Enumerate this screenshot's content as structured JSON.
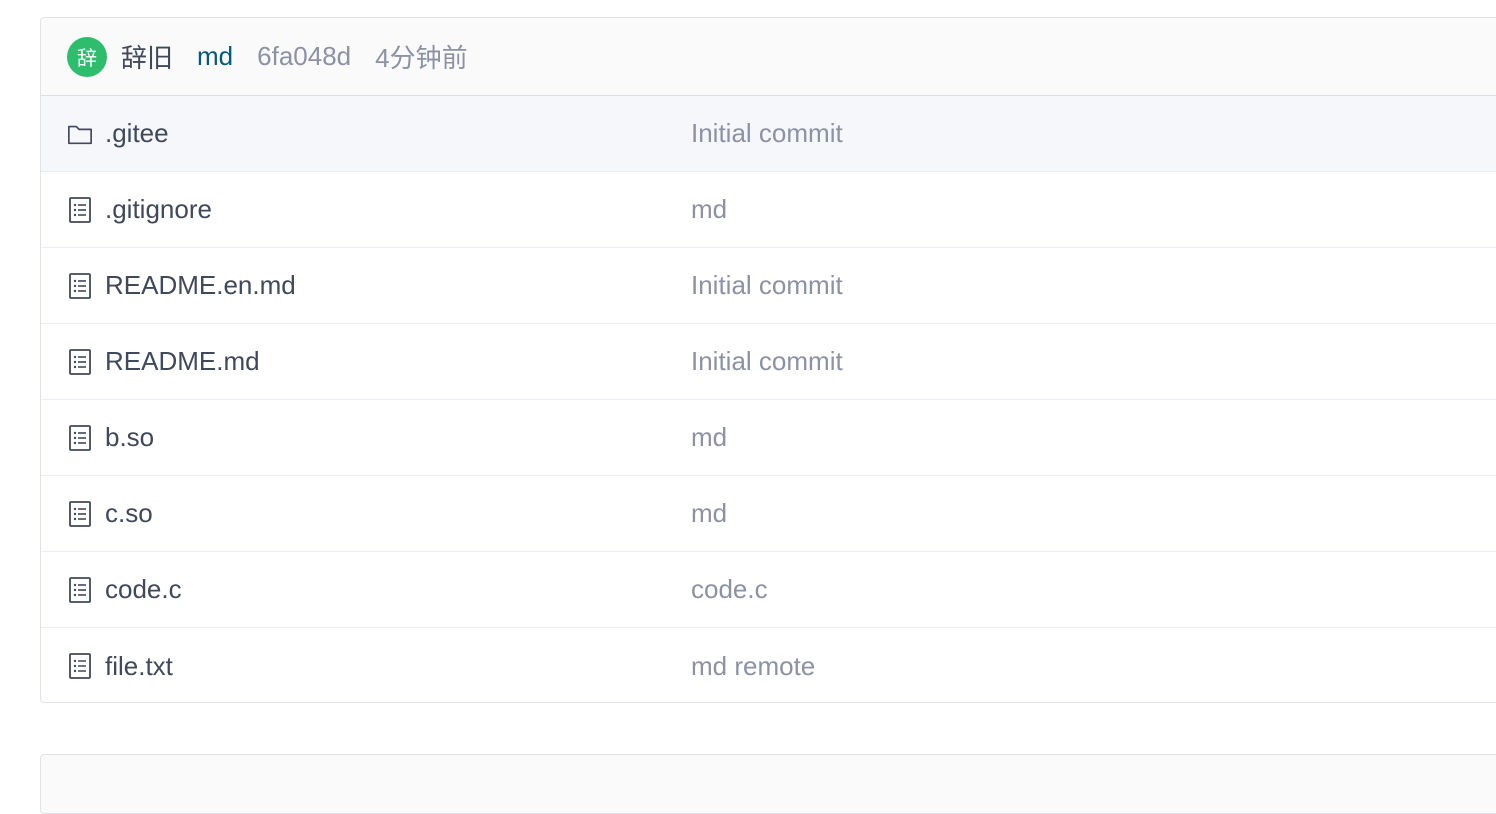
{
  "commit": {
    "avatar_char": "辞",
    "author": "辞旧",
    "message": "md",
    "sha": "6fa048d",
    "time": "4分钟前"
  },
  "files": [
    {
      "type": "folder",
      "icon": "folder-icon",
      "name": ".gitee",
      "commit": "Initial commit"
    },
    {
      "type": "file",
      "icon": "file-text-icon",
      "name": ".gitignore",
      "commit": "md"
    },
    {
      "type": "file",
      "icon": "file-text-icon",
      "name": "README.en.md",
      "commit": "Initial commit"
    },
    {
      "type": "file",
      "icon": "file-text-icon",
      "name": "README.md",
      "commit": "Initial commit"
    },
    {
      "type": "file",
      "icon": "file-text-icon",
      "name": "b.so",
      "commit": "md"
    },
    {
      "type": "file",
      "icon": "file-text-icon",
      "name": "c.so",
      "commit": "md"
    },
    {
      "type": "file",
      "icon": "file-text-icon",
      "name": "code.c",
      "commit": "code.c"
    },
    {
      "type": "file",
      "icon": "file-text-icon",
      "name": "file.txt",
      "commit": "md remote"
    }
  ],
  "colors": {
    "avatar_bg": "#2dbd6c",
    "link": "#005980",
    "muted": "#8c92a4",
    "text": "#40485b"
  }
}
